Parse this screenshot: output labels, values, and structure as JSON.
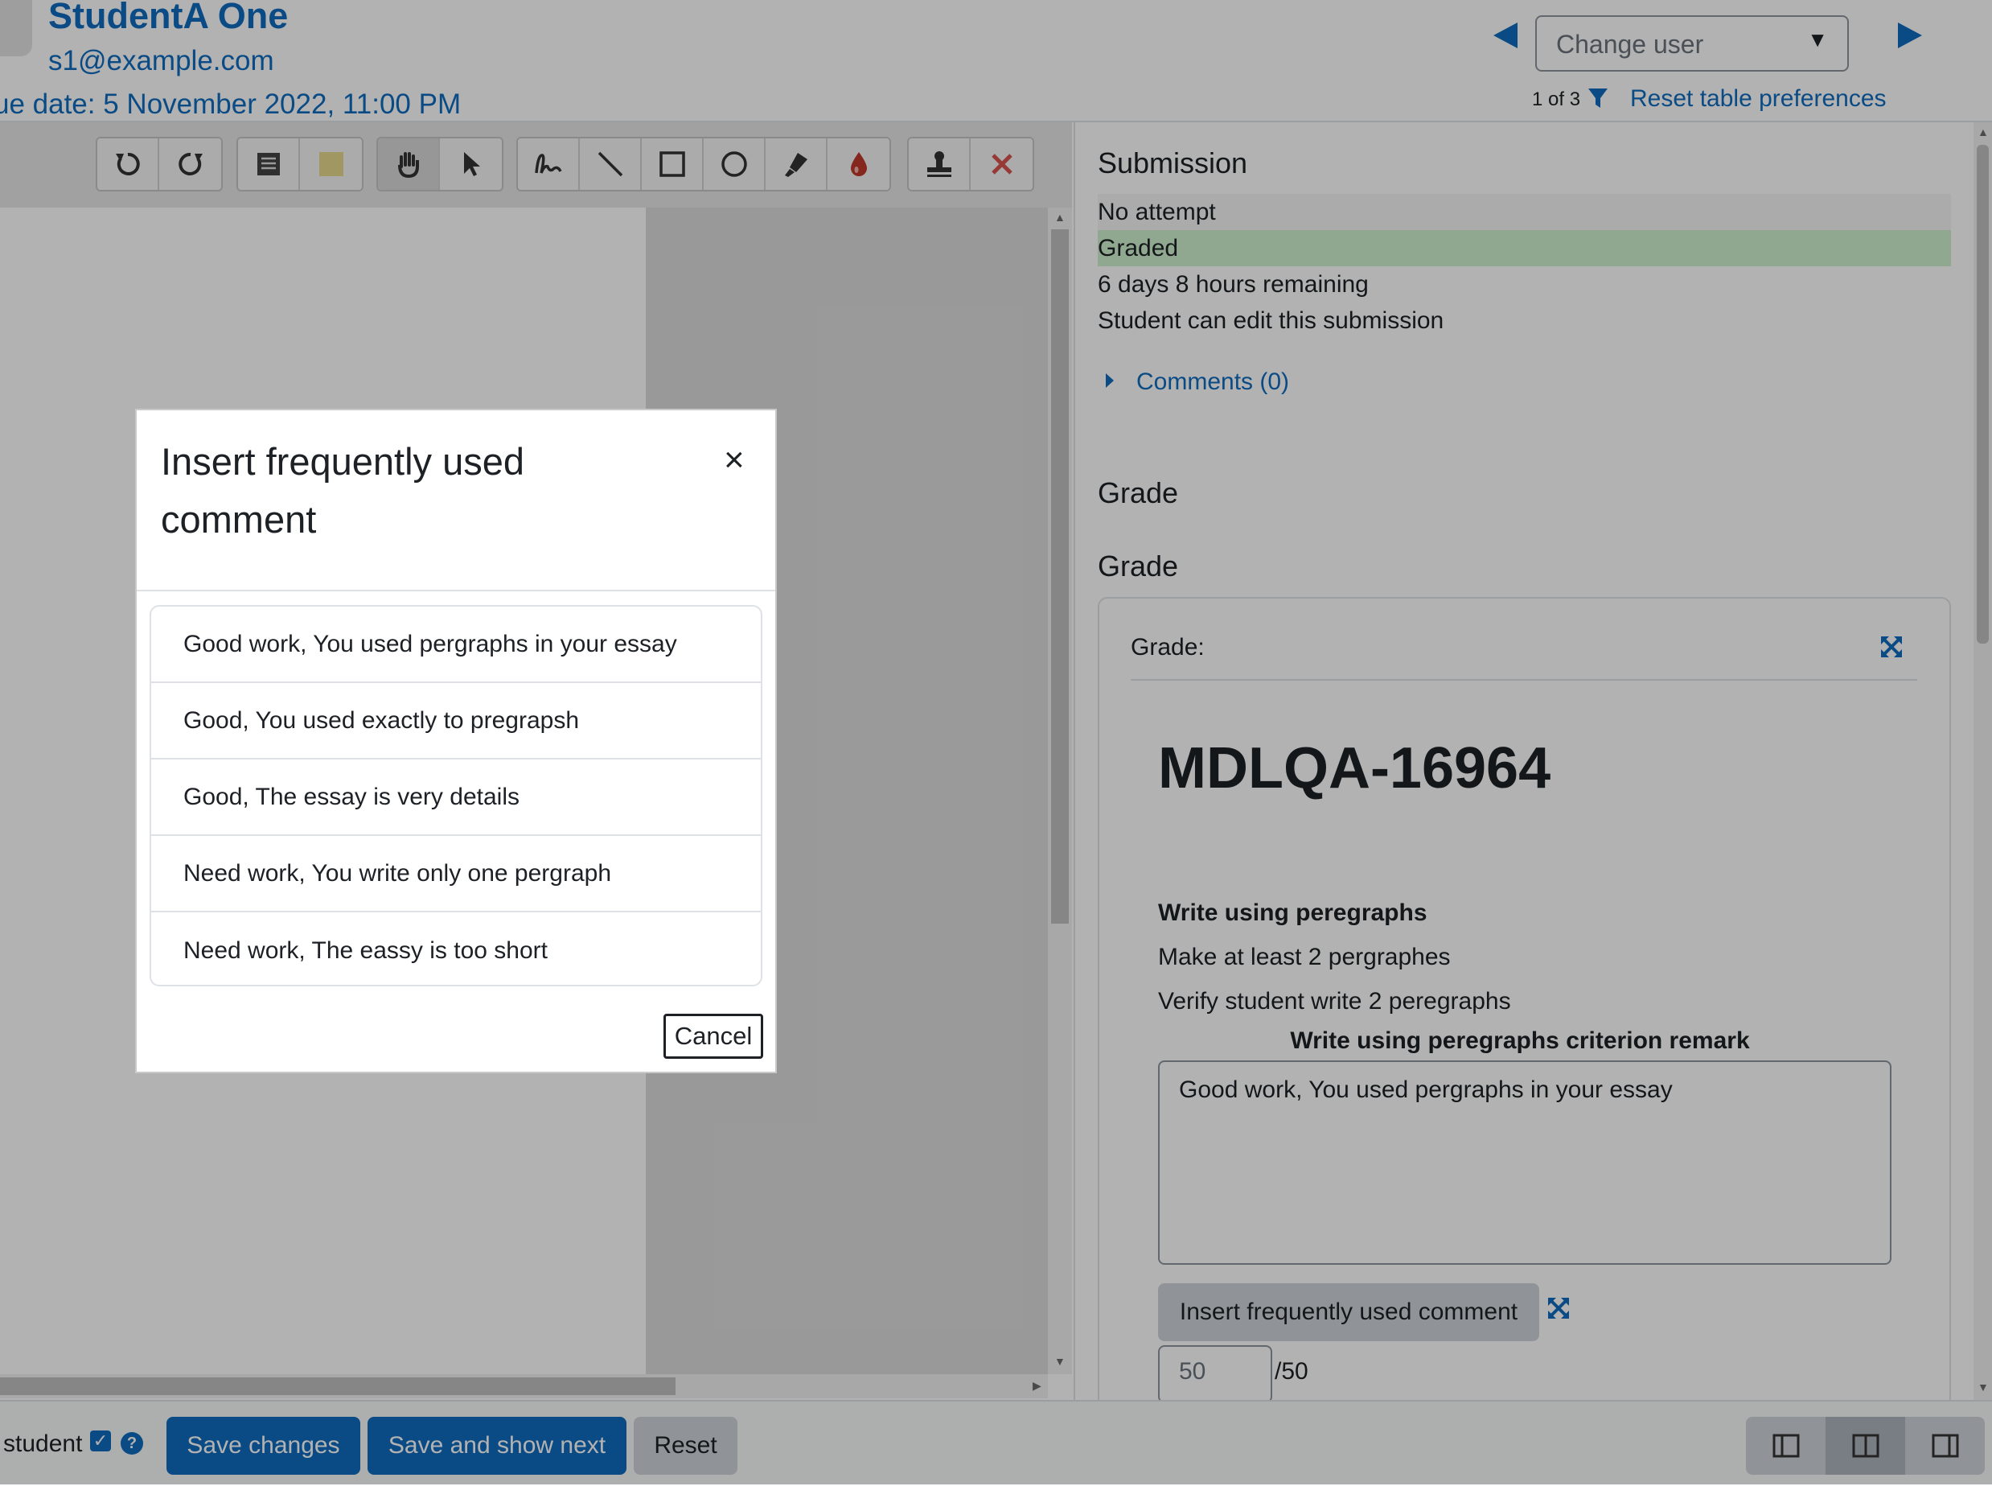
{
  "header": {
    "user_name": "StudentA One",
    "user_email": "s1@example.com",
    "due_date": "ue date: 5 November 2022, 11:00 PM",
    "change_user_placeholder": "Change user",
    "counter": "1 of 3",
    "reset_preferences": "Reset table preferences",
    "prev_icon": "triangle-left",
    "next_icon": "triangle-right"
  },
  "toolbar": {
    "groups": [
      [
        "rotate-left-icon",
        "rotate-right-icon"
      ],
      [
        "comment-icon",
        "comment-color-icon"
      ],
      [
        "pan-hand-icon",
        "select-pointer-icon"
      ],
      [
        "pen-icon",
        "line-icon",
        "rectangle-icon",
        "oval-icon",
        "highlighter-icon",
        "color-drop-icon"
      ],
      [
        "stamp-icon",
        "delete-icon"
      ]
    ]
  },
  "submission": {
    "title": "Submission",
    "status_attempt": "No attempt",
    "status_grading": "Graded",
    "time_remaining": "6 days 8 hours remaining",
    "edit_status": "Student can edit this submission",
    "comments_label": "Comments (0)"
  },
  "grade": {
    "section_title": "Grade",
    "subsection_title": "Grade",
    "grade_label": "Grade:",
    "rubric_title": "MDLQA-16964",
    "criterion_name": "Write using peregraphs",
    "criterion_line1": "Make at least 2 pergraphes",
    "criterion_line2": "Verify student write 2 peregraphs",
    "remark_label": "Write using peregraphs criterion remark",
    "remark_value": "Good work, You used pergraphs in your essay",
    "insert_button": "Insert frequently used comment",
    "score_value": "50",
    "score_max": "/50"
  },
  "footer": {
    "notify_label": "student",
    "save_changes": "Save changes",
    "save_and_next": "Save and show next",
    "reset": "Reset"
  },
  "modal": {
    "title": "Insert frequently used comment",
    "close_glyph": "×",
    "comments": [
      "Good work, You used pergraphs in your essay",
      "Good, You used exactly to pregrapsh",
      "Good, The essay is very details",
      "Need work, You write only one pergraph",
      "Need work, The eassy is too short"
    ],
    "cancel": "Cancel"
  },
  "colors": {
    "accent": "#0f6cbf",
    "graded_bg": "#cfefcf",
    "delete_red": "#d9534f",
    "drop_red": "#c0392b",
    "swatch_yellow": "#e7d98f"
  }
}
